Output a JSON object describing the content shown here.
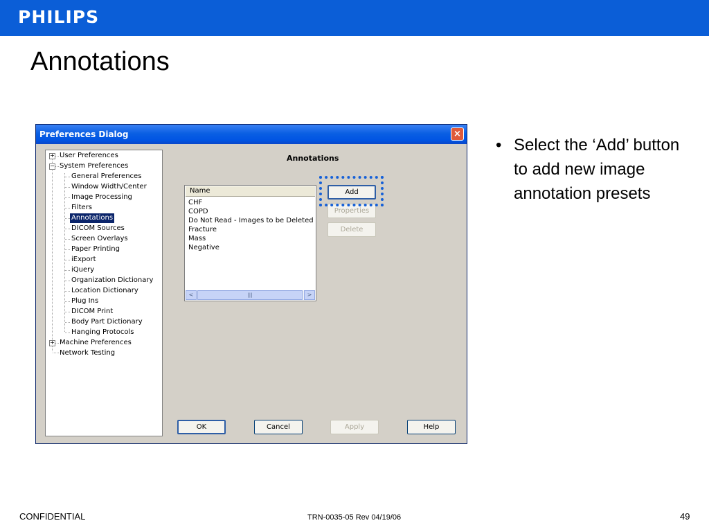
{
  "header": {
    "logo_text": "PHILIPS",
    "brand_color": "#0b5ed7"
  },
  "slide": {
    "title": "Annotations"
  },
  "dialog": {
    "title": "Preferences Dialog",
    "close_glyph": "×",
    "tree": {
      "items": [
        {
          "label": "User Preferences",
          "expander": "+"
        },
        {
          "label": "System Preferences",
          "expander": "−"
        },
        {
          "label": "General Preferences"
        },
        {
          "label": "Window Width/Center"
        },
        {
          "label": "Image Processing"
        },
        {
          "label": "Filters"
        },
        {
          "label": "Annotations",
          "selected": true
        },
        {
          "label": "DICOM Sources"
        },
        {
          "label": "Screen Overlays"
        },
        {
          "label": "Paper Printing"
        },
        {
          "label": "iExport"
        },
        {
          "label": "iQuery"
        },
        {
          "label": "Organization Dictionary"
        },
        {
          "label": "Location Dictionary"
        },
        {
          "label": "Plug Ins"
        },
        {
          "label": "DICOM Print"
        },
        {
          "label": "Body Part Dictionary"
        },
        {
          "label": "Hanging Protocols"
        },
        {
          "label": "Machine Preferences",
          "expander": "+"
        },
        {
          "label": "Network Testing"
        }
      ]
    },
    "panel": {
      "title": "Annotations",
      "list": {
        "header": "Name",
        "rows": [
          "CHF",
          "COPD",
          "Do Not Read - Images to be Deleted",
          "Fracture",
          "Mass",
          "Negative"
        ],
        "scroll_left": "<",
        "scroll_right": ">",
        "thumb_grip": "|||"
      },
      "buttons": {
        "add": "Add",
        "properties": "Properties",
        "delete": "Delete"
      }
    },
    "footer_buttons": {
      "ok": "OK",
      "cancel": "Cancel",
      "apply": "Apply",
      "help": "Help"
    },
    "highlight_color": "#1560d8"
  },
  "bullets": {
    "glyph": "•",
    "items": [
      "Select the ‘Add’ button to add new image annotation presets"
    ]
  },
  "footer": {
    "left": "CONFIDENTIAL",
    "center": "TRN-0035-05 Rev 04/19/06",
    "page": "49"
  }
}
